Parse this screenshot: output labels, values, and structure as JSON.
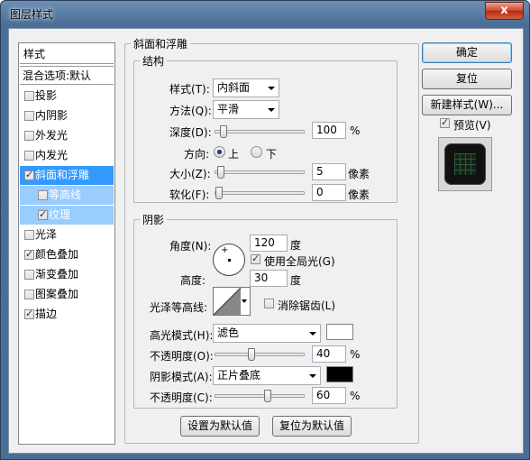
{
  "window": {
    "title": "图层样式",
    "close_label": "x"
  },
  "style_list": {
    "header": "样式",
    "blend_options": "混合选项:默认",
    "items": [
      {
        "label": "投影",
        "checked": false
      },
      {
        "label": "内阴影",
        "checked": false
      },
      {
        "label": "外发光",
        "checked": false
      },
      {
        "label": "内发光",
        "checked": false
      },
      {
        "label": "斜面和浮雕",
        "checked": true,
        "selected": true
      },
      {
        "label": "等高线",
        "checked": false,
        "sub": true
      },
      {
        "label": "纹理",
        "checked": true,
        "sub": true
      },
      {
        "label": "光泽",
        "checked": false
      },
      {
        "label": "颜色叠加",
        "checked": true
      },
      {
        "label": "渐变叠加",
        "checked": false
      },
      {
        "label": "图案叠加",
        "checked": false
      },
      {
        "label": "描边",
        "checked": true
      }
    ]
  },
  "bevel": {
    "group_title": "斜面和浮雕",
    "structure_title": "结构",
    "style_label": "样式(T):",
    "style_value": "内斜面",
    "technique_label": "方法(Q):",
    "technique_value": "平滑",
    "depth_label": "深度(D):",
    "depth_value": "100",
    "depth_unit": "%",
    "depth_level": 0.05,
    "direction_label": "方向:",
    "direction_up": "上",
    "direction_down": "下",
    "size_label": "大小(Z):",
    "size_value": "5",
    "size_unit": "像素",
    "size_level": 0.02,
    "soften_label": "软化(F):",
    "soften_value": "0",
    "soften_unit": "像素",
    "soften_level": 0.0
  },
  "shading": {
    "group_title": "阴影",
    "angle_label": "角度(N):",
    "angle_value": "120",
    "angle_unit": "度",
    "global_light_label": "使用全局光(G)",
    "altitude_label": "高度:",
    "altitude_value": "30",
    "altitude_unit": "度",
    "gloss_contour_label": "光泽等高线:",
    "antialias_label": "消除锯齿(L)",
    "highlight_mode_label": "高光模式(H):",
    "highlight_mode_value": "滤色",
    "highlight_color": "#ffffff",
    "highlight_opacity_label": "不透明度(O):",
    "highlight_opacity_value": "40",
    "highlight_opacity_unit": "%",
    "highlight_opacity_level": 0.4,
    "shadow_mode_label": "阴影模式(A):",
    "shadow_mode_value": "正片叠底",
    "shadow_color": "#000000",
    "shadow_opacity_label": "不透明度(C):",
    "shadow_opacity_value": "60",
    "shadow_opacity_unit": "%",
    "shadow_opacity_level": 0.6
  },
  "bottom_buttons": {
    "make_default": "设置为默认值",
    "reset_default": "复位为默认值"
  },
  "right_buttons": {
    "ok": "确定",
    "reset": "复位",
    "new_style": "新建样式(W)...",
    "preview_label": "预览(V)"
  }
}
